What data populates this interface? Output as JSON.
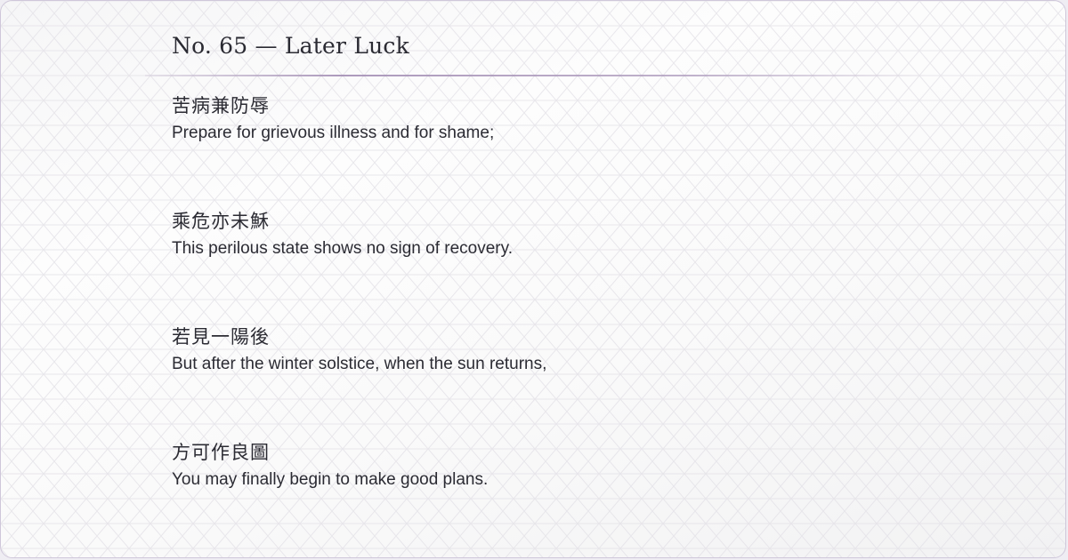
{
  "title": "No. 65 — Later Luck",
  "stanzas": [
    {
      "chinese": "苦病兼防辱",
      "english": "Prepare for grievous illness and for shame;"
    },
    {
      "chinese": "乘危亦未穌",
      "english": "This perilous state shows no sign of recovery."
    },
    {
      "chinese": "若見一陽後",
      "english": "But after the winter solstice, when the sun returns,"
    },
    {
      "chinese": "方可作良圖",
      "english": "You may finally begin to make good plans."
    }
  ],
  "colors": {
    "text": "#2b2b33",
    "rule": "#967daa",
    "border": "#cfc7da"
  }
}
